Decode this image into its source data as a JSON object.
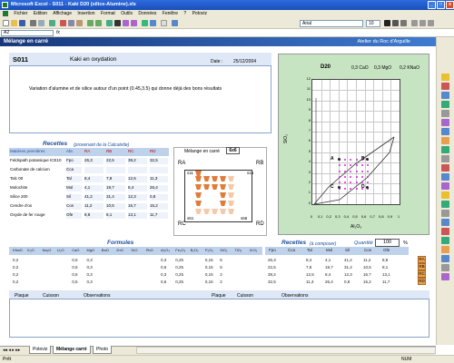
{
  "window": {
    "title": "Microsoft Excel - S011 - Kaki D20 (silice-Alumine).xls",
    "min": "_",
    "max": "□",
    "close": "x"
  },
  "menu": [
    "Fichier",
    "Edition",
    "Affichage",
    "Insertion",
    "Format",
    "Outils",
    "Données",
    "Fenêtre",
    "?",
    "Potoviz"
  ],
  "toolbar": {
    "font": "Arial",
    "size": "10"
  },
  "formula": {
    "cell": "A2",
    "fx": "fx"
  },
  "header": {
    "title": "Mélange en carré",
    "right": "Atelier du Roc d'Arguille"
  },
  "card": {
    "code": "S011",
    "name": "Kaki en oxydation",
    "date_label": "Date :",
    "date": "25/12/2004",
    "description": "Variation d'alumine et de silice autour d'un point (0.45,3.5) qui donne déjà des bons résultats"
  },
  "graph": {
    "title": "D20",
    "cao": "0,3 CaO",
    "mgo": "0,3 MgO",
    "kna": "0,2 KNaO",
    "ylabel": "SiO₂",
    "xlabel": "Al₂O₃",
    "yticks": [
      "12",
      "11",
      "10",
      "9",
      "8",
      "7",
      "6",
      "5",
      "4",
      "3",
      "2",
      "1",
      "0"
    ],
    "xticks": [
      "0",
      "0,1",
      "0,2",
      "0,3",
      "0,4",
      "0,5",
      "0,6",
      "0,7",
      "0,8",
      "0,9",
      "1"
    ],
    "points": [
      "A",
      "B",
      "C",
      "D"
    ]
  },
  "recettes": {
    "title": "Recettes",
    "sub": "(provenant de la Calculette)",
    "cols": [
      "Matières premières",
      "Abr.",
      "RA",
      "RB",
      "RC",
      "RD"
    ],
    "rows": [
      [
        "Feldspath potassique ICE10",
        "Fpo",
        "26,3",
        "22,5",
        "39,2",
        "32,5"
      ],
      [
        "Carbonate de calcium",
        "Cca",
        "",
        "",
        "",
        ""
      ],
      [
        "Talc 00",
        "Tal",
        "8,4",
        "7,8",
        "12,5",
        "11,3"
      ],
      [
        "Molochite",
        "Mol",
        "4,1",
        "19,7",
        "8,4",
        "26,4"
      ],
      [
        "Silice 200",
        "Sil",
        "41,2",
        "31,4",
        "12,3",
        "0,8"
      ],
      [
        "Cendre d'os",
        "Cos",
        "11,2",
        "10,5",
        "16,7",
        "15,2"
      ],
      [
        "Oxyde de fer rouge",
        "Ofe",
        "8,8",
        "8,1",
        "13,1",
        "11,7"
      ]
    ]
  },
  "melange": {
    "label": "Mélange en carré",
    "value": "6x6",
    "corners": [
      "RA",
      "RB",
      "RC",
      "RD"
    ],
    "cells": [
      "s11",
      "s16",
      "s61",
      "s66"
    ]
  },
  "formules": {
    "title": "Formules",
    "cols": [
      "KNaO",
      "K₂O",
      "Na₂O",
      "Li₂O",
      "CaO",
      "MgO",
      "BaO",
      "ZnO",
      "SrO",
      "PbO",
      "Al₂O₃",
      "Fe₂O₃",
      "B₂O₃",
      "P₂O₅",
      "SiO₂",
      "TiO₂",
      "ZrO₂"
    ],
    "rows": [
      [
        "0,2",
        "",
        "",
        "",
        "0,5",
        "0,3",
        "",
        "",
        "",
        "",
        "0,3",
        "0,25",
        "",
        "0,15",
        "5",
        "",
        ""
      ],
      [
        "0,2",
        "",
        "",
        "",
        "0,5",
        "0,3",
        "",
        "",
        "",
        "",
        "0,6",
        "0,25",
        "",
        "0,15",
        "5",
        "",
        ""
      ],
      [
        "0,2",
        "",
        "",
        "",
        "0,5",
        "0,3",
        "",
        "",
        "",
        "",
        "0,3",
        "0,25",
        "",
        "0,15",
        "2",
        "",
        ""
      ],
      [
        "0,2",
        "",
        "",
        "",
        "0,5",
        "0,3",
        "",
        "",
        "",
        "",
        "0,6",
        "0,25",
        "",
        "0,15",
        "2",
        "",
        ""
      ]
    ]
  },
  "recettes2": {
    "title": "Recettes",
    "sub": "(à composer)",
    "qlabel": "Quantité",
    "qval": "100",
    "qpct": "%",
    "cols": [
      "Fpo",
      "Cca",
      "Tal",
      "Mol",
      "Sil",
      "Cos",
      "Ofe"
    ],
    "rows": [
      [
        "26,3",
        "",
        "8,4",
        "4,1",
        "41,2",
        "11,2",
        "8,8"
      ],
      [
        "22,5",
        "",
        "7,8",
        "19,7",
        "31,4",
        "10,5",
        "8,1"
      ],
      [
        "39,2",
        "",
        "12,5",
        "8,4",
        "12,3",
        "16,7",
        "13,1"
      ],
      [
        "32,5",
        "",
        "11,3",
        "26,4",
        "0,8",
        "15,2",
        "11,7"
      ]
    ],
    "buttons": [
      "RA",
      "RB",
      "RC",
      "RD"
    ]
  },
  "notes": {
    "cols": [
      "Plaque",
      "Cuisson",
      "Observations",
      "Plaque",
      "Cuisson",
      "Observations"
    ]
  },
  "tabs": [
    "Potoviz",
    "Mélange carré",
    "Photo"
  ],
  "status": {
    "left": "Prêt",
    "right": "NUM"
  },
  "colors": {
    "accent": "#1b4e9c",
    "graph_bg": "#c7e4c2",
    "highlight": "#e020e0"
  }
}
